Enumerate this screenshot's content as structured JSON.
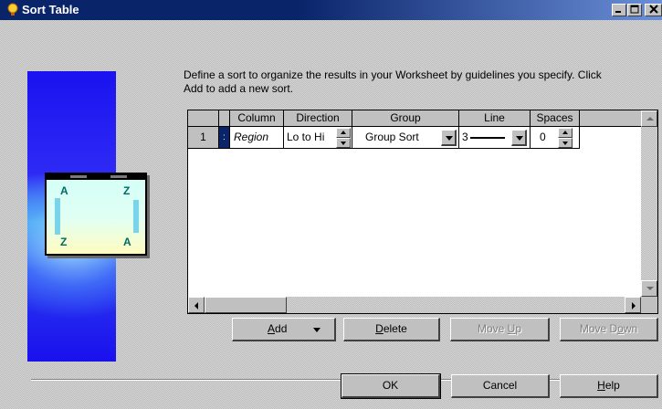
{
  "window": {
    "title": "Sort Table"
  },
  "description": "Define a sort to organize the results in your Worksheet by guidelines you specify. Click Add to add a new sort.",
  "illustration": {
    "top_left": "A",
    "top_right": "Z",
    "bottom_left": "Z",
    "bottom_right": "A"
  },
  "table": {
    "columns": [
      "Column",
      "Direction",
      "Group",
      "Line",
      "Spaces"
    ],
    "rows": [
      {
        "row_num": "1",
        "column": "Region",
        "direction": "Lo to Hi",
        "group": "Group Sort",
        "line": "3",
        "spaces": "0"
      }
    ]
  },
  "buttons": {
    "add_prefix": "",
    "add_hot": "A",
    "add_suffix": "dd",
    "delete_hot": "D",
    "delete_suffix": "elete",
    "moveup_prefix": "Move ",
    "moveup_hot": "U",
    "moveup_suffix": "p",
    "movedown_prefix": "Move D",
    "movedown_hot": "o",
    "movedown_suffix": "wn",
    "ok": "OK",
    "cancel": "Cancel",
    "help_hot": "H",
    "help_suffix": "elp"
  },
  "icons": {
    "title_icon": "lightbulb-icon",
    "minimize": "minimize-icon",
    "maximize": "maximize-icon",
    "close": "close-icon"
  }
}
